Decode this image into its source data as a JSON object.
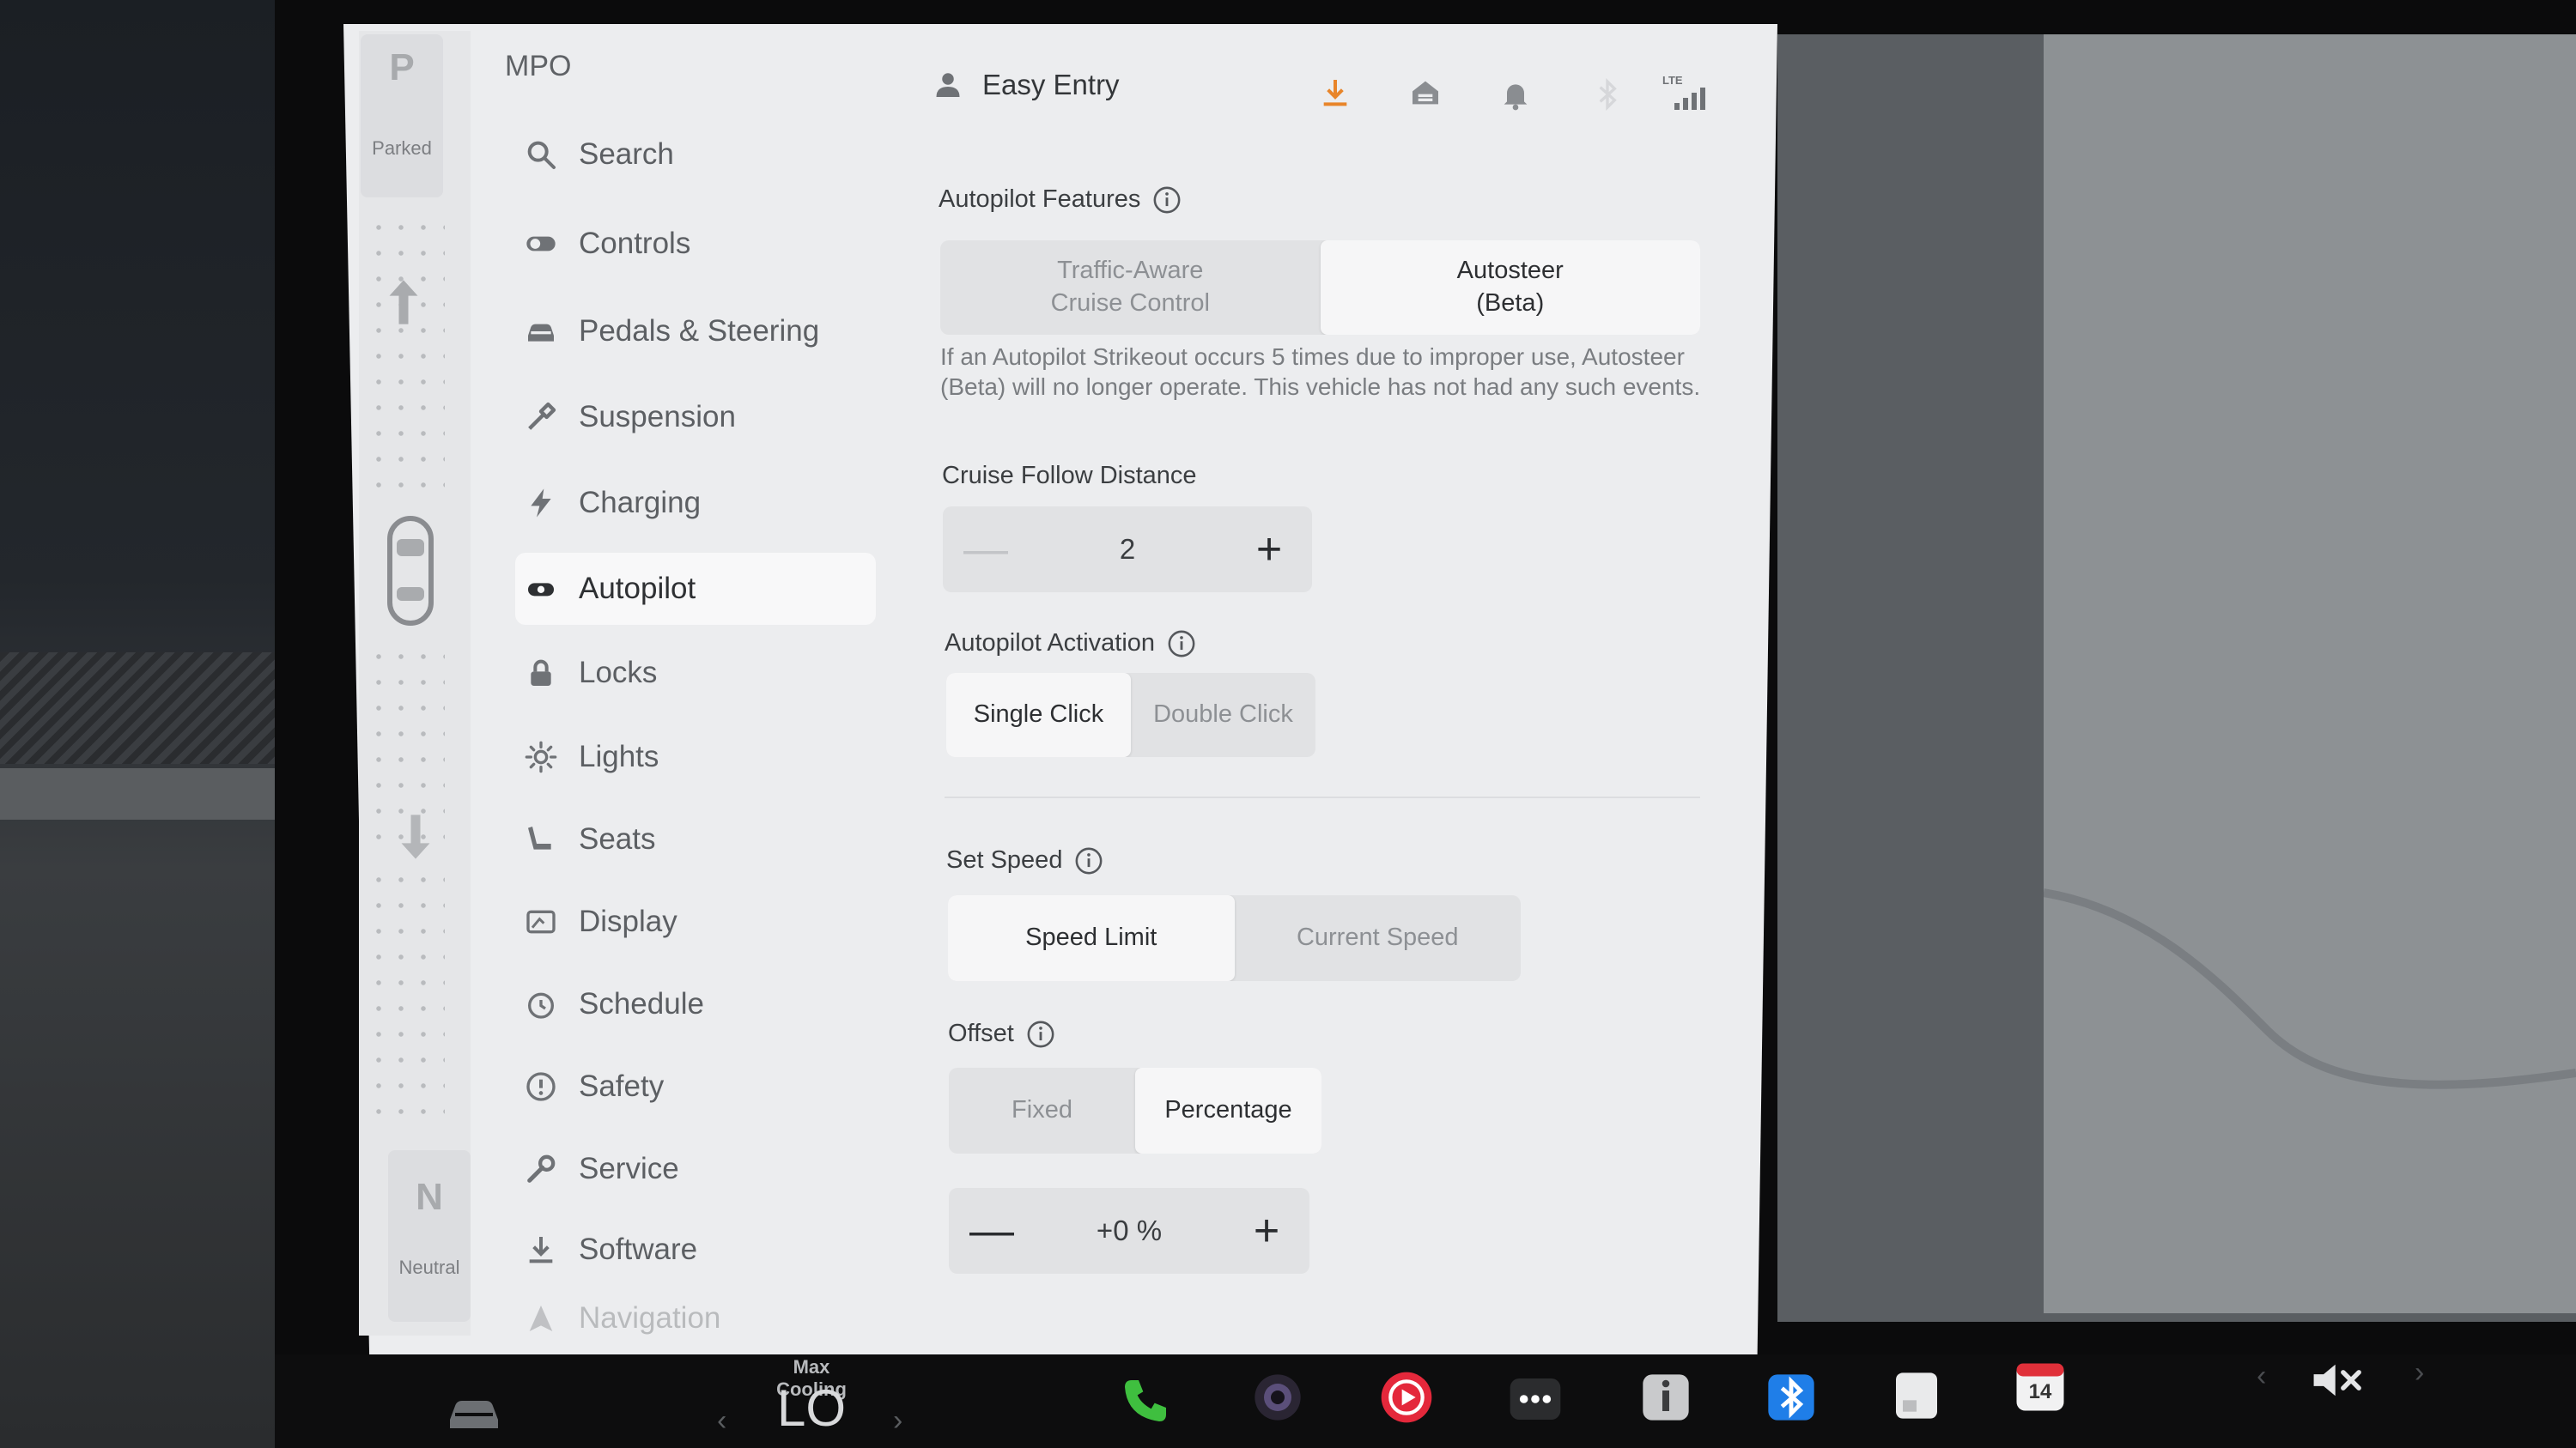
{
  "drive": {
    "gear_top": "P",
    "gear_top_state": "Parked",
    "gear_bottom": "N",
    "gear_bottom_state": "Neutral"
  },
  "sidebar": {
    "profile_name": "MPO",
    "items": [
      {
        "label": "Search",
        "icon": "search-icon"
      },
      {
        "label": "Controls",
        "icon": "toggle-icon"
      },
      {
        "label": "Pedals & Steering",
        "icon": "car-icon"
      },
      {
        "label": "Suspension",
        "icon": "wrench-icon"
      },
      {
        "label": "Charging",
        "icon": "lightning-icon"
      },
      {
        "label": "Autopilot",
        "icon": "steering-wheel-icon",
        "active": true
      },
      {
        "label": "Locks",
        "icon": "lock-icon"
      },
      {
        "label": "Lights",
        "icon": "sun-icon"
      },
      {
        "label": "Seats",
        "icon": "seat-icon"
      },
      {
        "label": "Display",
        "icon": "display-icon"
      },
      {
        "label": "Schedule",
        "icon": "clock-icon"
      },
      {
        "label": "Safety",
        "icon": "alert-icon"
      },
      {
        "label": "Service",
        "icon": "wrench-icon"
      },
      {
        "label": "Software",
        "icon": "download-icon"
      },
      {
        "label": "Navigation",
        "icon": "navigation-icon"
      }
    ]
  },
  "header": {
    "profile_label": "Easy Entry",
    "icons": [
      "download-icon",
      "home-icon",
      "bell-icon",
      "bluetooth-icon",
      "lte-signal-icon"
    ],
    "lte": "LTE"
  },
  "autopilot": {
    "features_title": "Autopilot Features",
    "features_options": [
      "Traffic-Aware\nCruise Control",
      "Autosteer\n(Beta)"
    ],
    "features_selected": 1,
    "strikeout_note": "If an Autopilot Strikeout occurs 5 times due to improper use, Autosteer (Beta) will no longer operate. This vehicle has not had any such events.",
    "follow_title": "Cruise Follow Distance",
    "follow_value": "2",
    "activation_title": "Autopilot Activation",
    "activation_options": [
      "Single Click",
      "Double Click"
    ],
    "activation_selected": 0,
    "set_speed_title": "Set Speed",
    "set_speed_options": [
      "Speed Limit",
      "Current Speed"
    ],
    "set_speed_selected": 0,
    "offset_title": "Offset",
    "offset_options": [
      "Fixed",
      "Percentage"
    ],
    "offset_selected": 1,
    "offset_value": "+0 %",
    "minus": "—",
    "plus": "+"
  },
  "taskbar": {
    "climate_label": "Max Cooling",
    "climate_value": "LO",
    "calendar_day": "14"
  },
  "colors": {
    "accent_download": "#e8852a",
    "phone_green": "#3fbf3f",
    "media_red": "#e4283b",
    "bluetooth_blue": "#1f7ee8",
    "calendar_red": "#e0303a"
  }
}
